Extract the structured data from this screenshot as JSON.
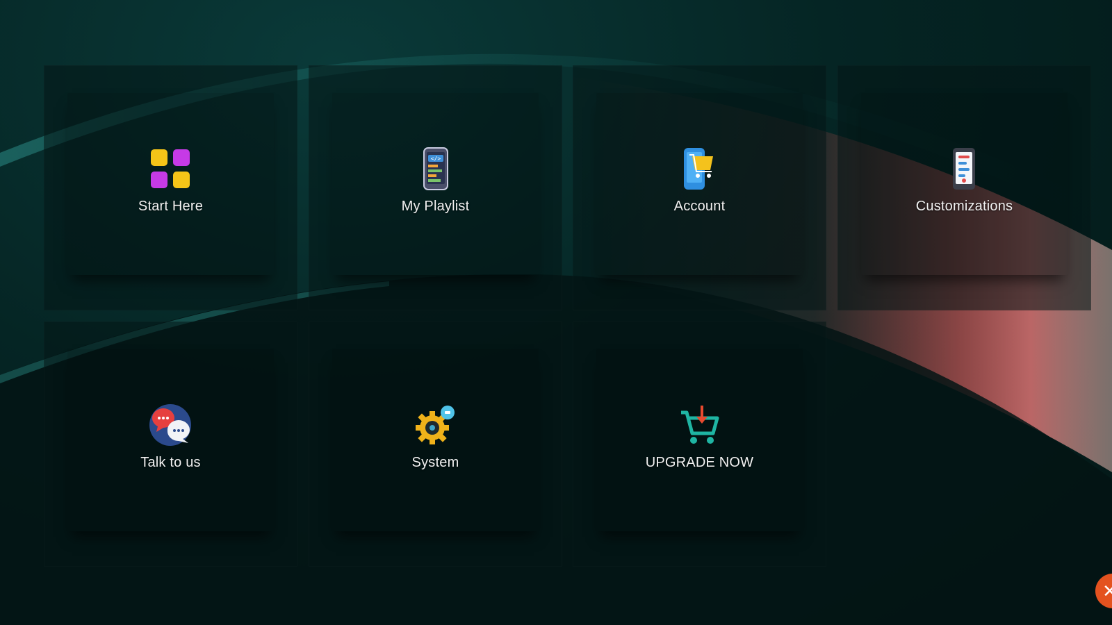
{
  "tiles": [
    {
      "label": "Start Here",
      "icon": "grid-apps-icon"
    },
    {
      "label": "My Playlist",
      "icon": "phone-code-icon"
    },
    {
      "label": "Account",
      "icon": "phone-cart-icon"
    },
    {
      "label": "Customizations",
      "icon": "phone-sliders-icon"
    },
    {
      "label": "Talk to us",
      "icon": "chat-bubbles-icon"
    },
    {
      "label": "System",
      "icon": "gear-icon"
    },
    {
      "label": "UPGRADE NOW",
      "icon": "cart-download-icon"
    }
  ],
  "close_button": {
    "glyph": "✕",
    "icon": "close-icon"
  },
  "colors": {
    "background": "#041c1c",
    "accent_red": "#e06767",
    "close_orange": "#e4521f"
  }
}
